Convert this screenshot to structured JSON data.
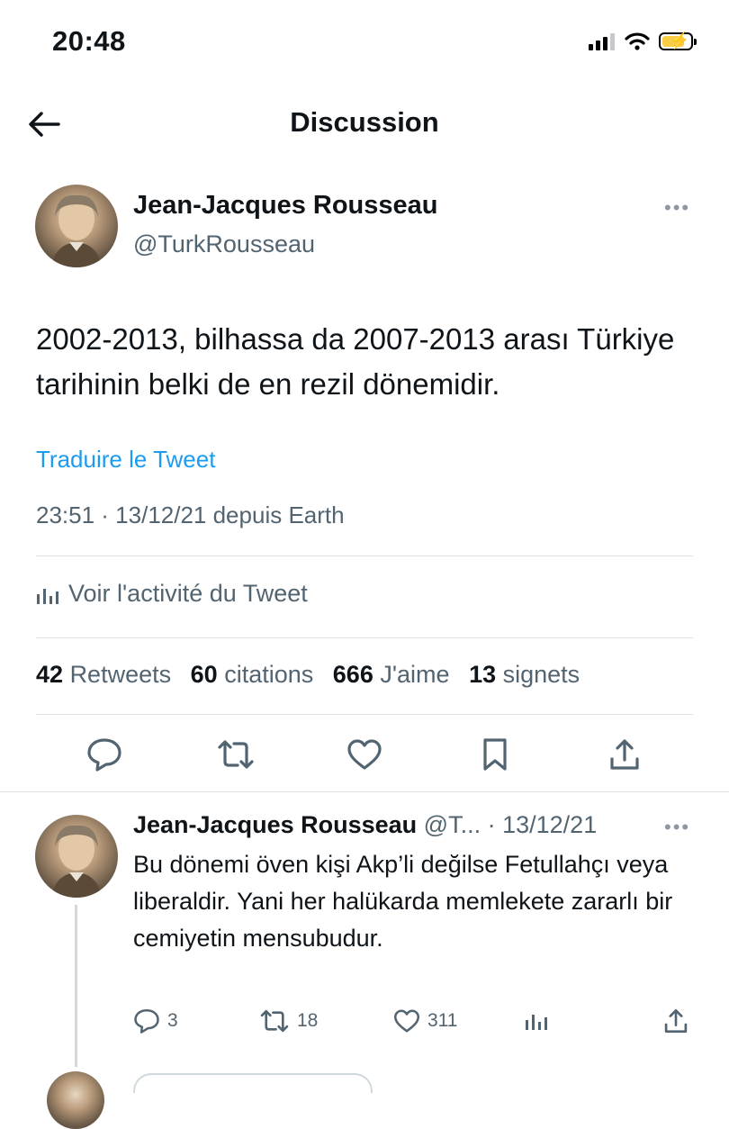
{
  "status_bar": {
    "time": "20:48"
  },
  "header": {
    "title": "Discussion"
  },
  "tweet": {
    "author_name": "Jean-Jacques Rousseau",
    "author_handle": "@TurkRousseau",
    "text": "2002-2013, bilhassa da 2007-2013 arası Türkiye tarihinin belki de en rezil dönemidir.",
    "translate_label": "Traduire le Tweet",
    "meta": "23:51 · 13/12/21 depuis Earth",
    "activity_label": "Voir l'activité du Tweet",
    "stats": {
      "retweets_count": "42",
      "retweets_label": "Retweets",
      "quotes_count": "60",
      "quotes_label": "citations",
      "likes_count": "666",
      "likes_label": "J'aime",
      "bookmarks_count": "13",
      "bookmarks_label": "signets"
    }
  },
  "reply": {
    "author_name": "Jean-Jacques Rousseau",
    "author_handle": "@T...",
    "date": "13/12/21",
    "text": "Bu dönemi öven kişi Akp’li değilse Fetullahçı veya liberaldir. Yani her halükarda memlekete zararlı bir cemiyetin mensubudur.",
    "reply_count": "3",
    "retweet_count": "18",
    "like_count": "311"
  },
  "icons": {
    "back": "arrow-left-icon",
    "more": "more-dots-icon",
    "reply": "speech-bubble-icon",
    "retweet": "retweet-icon",
    "like": "heart-icon",
    "bookmark": "bookmark-icon",
    "share": "share-icon",
    "views": "bar-chart-icon"
  },
  "colors": {
    "link": "#1d9bf0",
    "secondary_text": "#536471",
    "divider": "#dfe3e6"
  }
}
